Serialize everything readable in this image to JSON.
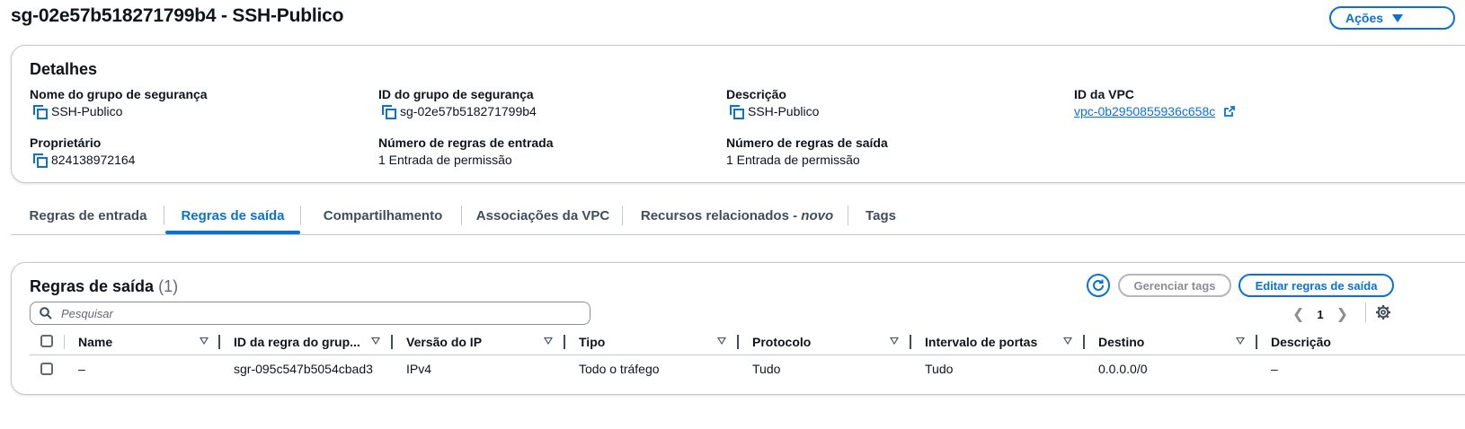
{
  "header": {
    "title": "sg-02e57b518271799b4 - SSH-Publico",
    "actions_label": "Ações"
  },
  "details": {
    "title": "Detalhes",
    "fields": {
      "sg_name": {
        "label": "Nome do grupo de segurança",
        "value": "SSH-Publico"
      },
      "sg_id": {
        "label": "ID do grupo de segurança",
        "value": "sg-02e57b518271799b4"
      },
      "description": {
        "label": "Descrição",
        "value": "SSH-Publico"
      },
      "vpc_id": {
        "label": "ID da VPC",
        "value": "vpc-0b2950855936c658c"
      },
      "owner": {
        "label": "Proprietário",
        "value": "824138972164"
      },
      "inbound_count": {
        "label": "Número de regras de entrada",
        "value": "1 Entrada de permissão"
      },
      "outbound_count": {
        "label": "Número de regras de saída",
        "value": "1 Entrada de permissão"
      }
    }
  },
  "tabs": {
    "inbound": "Regras de entrada",
    "outbound": "Regras de saída",
    "sharing": "Compartilhamento",
    "vpc_assoc": "Associações da VPC",
    "related_prefix": "Recursos relacionados - ",
    "related_new": "novo",
    "tags": "Tags",
    "active": "outbound"
  },
  "rules": {
    "title": "Regras de saída",
    "count": "(1)",
    "manage_tags_label": "Gerenciar tags",
    "edit_label": "Editar regras de saída",
    "search_placeholder": "Pesquisar",
    "page": "1",
    "columns": {
      "name": "Name",
      "rule_id": "ID da regra do grup...",
      "ip_version": "Versão do IP",
      "type": "Tipo",
      "protocol": "Protocolo",
      "port_range": "Intervalo de portas",
      "destination": "Destino",
      "description": "Descrição"
    },
    "rows": [
      {
        "name": "–",
        "rule_id": "sgr-095c547b5054cbad3",
        "ip_version": "IPv4",
        "type": "Todo o tráfego",
        "protocol": "Tudo",
        "port_range": "Tudo",
        "destination": "0.0.0.0/0",
        "description": "–"
      }
    ]
  },
  "colors": {
    "accent": "#0972d3",
    "text": "#0f141a",
    "muted": "#656871",
    "border": "#c6c6cd"
  },
  "icons": [
    "chevron-down-icon",
    "copy-icon",
    "external-link-icon",
    "refresh-icon",
    "search-icon",
    "chevron-left-icon",
    "chevron-right-icon",
    "settings-gear-icon",
    "sort-icon"
  ]
}
